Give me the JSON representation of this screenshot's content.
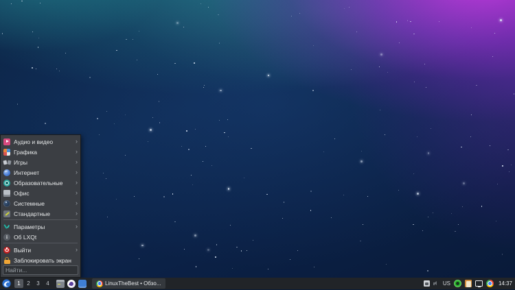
{
  "menu": {
    "items": [
      {
        "label": "Аудио и видео",
        "icon": "audio-video-icon",
        "submenu": true
      },
      {
        "label": "Графика",
        "icon": "graphics-icon",
        "submenu": true
      },
      {
        "label": "Игры",
        "icon": "games-icon",
        "submenu": true
      },
      {
        "label": "Интернет",
        "icon": "internet-icon",
        "submenu": true
      },
      {
        "label": "Образовательные",
        "icon": "education-icon",
        "submenu": true
      },
      {
        "label": "Офис",
        "icon": "office-icon",
        "submenu": true
      },
      {
        "label": "Системные",
        "icon": "system-icon",
        "submenu": true
      },
      {
        "label": "Стандартные",
        "icon": "accessories-icon",
        "submenu": true,
        "separator_after": true
      },
      {
        "label": "Параметры",
        "icon": "settings-icon",
        "submenu": true
      },
      {
        "label": "Об LXQt",
        "icon": "about-lxqt-icon",
        "submenu": false,
        "separator_after": true
      },
      {
        "label": "Выйти",
        "icon": "logout-icon",
        "submenu": true
      },
      {
        "label": "Заблокировать экран",
        "icon": "lock-screen-icon",
        "submenu": false
      }
    ],
    "submenu_arrow": "›",
    "search_placeholder": "Найти..."
  },
  "taskbar": {
    "workspaces": [
      "1",
      "2",
      "3",
      "4"
    ],
    "active_workspace": "1",
    "quick_launch": [
      "terminal-icon",
      "paint-app-icon",
      "messenger-icon"
    ],
    "task_title": "LinuxTheBest • Обзо...",
    "tray": {
      "icons_left": [
        "keyboard-indicator-icon",
        "volume-icon"
      ],
      "keyboard_layout": "US",
      "icons_right": [
        "recorder-icon",
        "clipboard-icon",
        "screen-icon",
        "chrome-icon"
      ],
      "clock": "14:37"
    }
  },
  "colors": {
    "panel_bg": "#212428",
    "menu_bg": "#3b3e43",
    "active_workspace_bg": "#53575d",
    "nebula_teal": "#2ca2a6",
    "nebula_purple": "#b23ada",
    "nebula_navy": "#0d2950",
    "audio_pink": "#d84a7f",
    "logout_red": "#d42a2a",
    "lock_orange": "#f0a636"
  }
}
